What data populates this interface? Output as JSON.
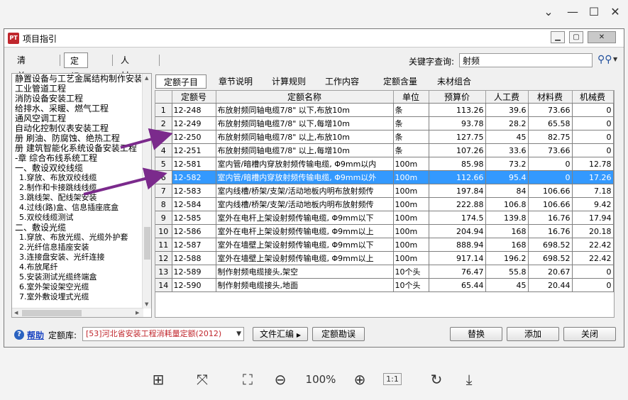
{
  "dialog": {
    "title": "项目指引",
    "app_icon_text": "PT"
  },
  "top_tabs": [
    "清  单",
    "定  额",
    "人材机"
  ],
  "keyword": {
    "label": "关键字查询:",
    "value": "射频"
  },
  "tree_items": [
    {
      "text": "静置设备与工艺金属结构制作安装",
      "level": 1
    },
    {
      "text": "工业管道工程",
      "level": 1
    },
    {
      "text": "消防设备安装工程",
      "level": 1
    },
    {
      "text": "给排水、采暖、燃气工程",
      "level": 1
    },
    {
      "text": "通风空调工程",
      "level": 1
    },
    {
      "text": "自动化控制仪表安装工程",
      "level": 1
    },
    {
      "text": "册 刷油、防腐蚀、绝热工程",
      "level": 1
    },
    {
      "text": "册 建筑智能化系统设备安装工程",
      "level": 1
    },
    {
      "text": "-章 综合布线系统工程",
      "level": 1
    },
    {
      "text": "一、敷设双绞线缆",
      "level": 1
    },
    {
      "text": "1.穿放、布放双绞线缆",
      "level": 2
    },
    {
      "text": "2.制作和卡接跳线线缆",
      "level": 2
    },
    {
      "text": "3.跳线架、配线架安装",
      "level": 2
    },
    {
      "text": "4.过线(路)盒、信息插座底盒",
      "level": 2
    },
    {
      "text": "5.双绞线缆测试",
      "level": 2
    },
    {
      "text": "二、敷设光缆",
      "level": 1
    },
    {
      "text": "1.穿放、布放光缆、光缆外护套",
      "level": 2
    },
    {
      "text": "2.光纤信息插座安装",
      "level": 2
    },
    {
      "text": "3.连接盘安装、光纤连接",
      "level": 2
    },
    {
      "text": "4.布放尾纤",
      "level": 2
    },
    {
      "text": "5.安装测试光缆终端盒",
      "level": 2
    },
    {
      "text": "6.室外架设架空光缆",
      "level": 2
    },
    {
      "text": "7.室外敷设埋式光缆",
      "level": 2
    }
  ],
  "right_tabs": [
    "定额子目",
    "章节说明",
    "计算规则",
    "工作内容",
    "定额含量",
    "未材组合"
  ],
  "grid": {
    "headers": [
      "",
      "定额号",
      "定额名称",
      "单位",
      "预算价",
      "人工费",
      "材料费",
      "机械费"
    ],
    "rows": [
      [
        "1",
        "12-248",
        "布放射频同轴电缆7/8\" 以下,布放10m",
        "条",
        "113.26",
        "39.6",
        "73.66",
        "0"
      ],
      [
        "2",
        "12-249",
        "布放射频同轴电缆7/8\" 以下,每增10m",
        "条",
        "93.78",
        "28.2",
        "65.58",
        "0"
      ],
      [
        "3",
        "12-250",
        "布放射频同轴电缆7/8\" 以上,布放10m",
        "条",
        "127.75",
        "45",
        "82.75",
        "0"
      ],
      [
        "4",
        "12-251",
        "布放射频同轴电缆7/8\" 以上,每增10m",
        "条",
        "107.26",
        "33.6",
        "73.66",
        "0"
      ],
      [
        "5",
        "12-581",
        "室内管/暗槽内穿放射频传输电缆, Φ9mm以内",
        "100m",
        "85.98",
        "73.2",
        "0",
        "12.78"
      ],
      [
        "6",
        "12-582",
        "室内管/暗槽内穿放射频传输电缆, Φ9mm以外",
        "100m",
        "112.66",
        "95.4",
        "0",
        "17.26"
      ],
      [
        "7",
        "12-583",
        "室内线槽/桥架/支架/活动地板内明布放射频传",
        "100m",
        "197.84",
        "84",
        "106.66",
        "7.18"
      ],
      [
        "8",
        "12-584",
        "室内线槽/桥架/支架/活动地板内明布放射频传",
        "100m",
        "222.88",
        "106.8",
        "106.66",
        "9.42"
      ],
      [
        "9",
        "12-585",
        "室外在电杆上架设射频传输电缆, Φ9mm以下",
        "100m",
        "174.5",
        "139.8",
        "16.76",
        "17.94"
      ],
      [
        "10",
        "12-586",
        "室外在电杆上架设射频传输电缆, Φ9mm以上",
        "100m",
        "204.94",
        "168",
        "16.76",
        "20.18"
      ],
      [
        "11",
        "12-587",
        "室外在墙壁上架设射频传输电缆, Φ9mm以下",
        "100m",
        "888.94",
        "168",
        "698.52",
        "22.42"
      ],
      [
        "12",
        "12-588",
        "室外在墙壁上架设射频传输电缆, Φ9mm以上",
        "100m",
        "917.14",
        "196.2",
        "698.52",
        "22.42"
      ],
      [
        "13",
        "12-589",
        "制作射频电缆接头,架空",
        "10个头",
        "76.47",
        "55.8",
        "20.67",
        "0"
      ],
      [
        "14",
        "12-590",
        "制作射频电缆接头,地面",
        "10个头",
        "65.44",
        "45",
        "20.44",
        "0"
      ]
    ],
    "selected_row": 6
  },
  "bottom": {
    "help": "帮助",
    "lib_label": "定额库:",
    "lib_value": "[53]河北省安装工程消耗量定额(2012)",
    "btn_files": "文件汇编",
    "btn_errata": "定额勘误",
    "btn_replace": "替换",
    "btn_add": "添加",
    "btn_close": "关闭"
  },
  "viewer": {
    "zoom": "100%",
    "actual_size": "1:1"
  },
  "colors": {
    "selection": "#3399ff",
    "arrow": "#7b2a8c",
    "library": "#c0272d"
  }
}
